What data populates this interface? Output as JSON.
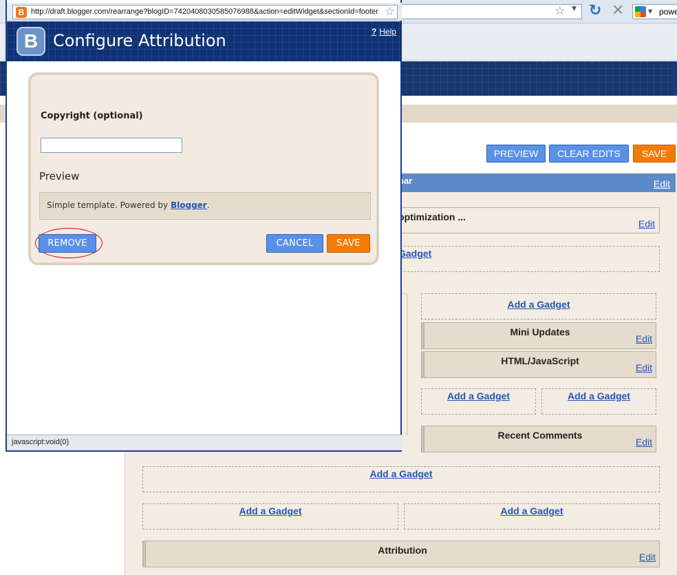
{
  "browser": {
    "search_text": "powe"
  },
  "page": {
    "actions": {
      "preview": "PREVIEW",
      "clear_edits": "CLEAR EDITS",
      "save": "SAVE"
    },
    "sidebar_title_fragment": "bar",
    "sidebar_edit": "Edit",
    "fragment_optimization": "optimization ...",
    "fragment_gadget": "Gadget",
    "edit_label": "Edit",
    "add_gadget": "Add a Gadget",
    "gadgets": {
      "mini_updates": "Mini Updates",
      "html_javascript": "HTML/JavaScript",
      "recent_comments": "Recent Comments",
      "attribution": "Attribution"
    }
  },
  "popup": {
    "url": "http://draft.blogger.com/rearrange?blogID=7420408030585076988&action=editWidget&sectionId=footer",
    "favicon_letter": "B",
    "logo_letter": "B",
    "title": "Configure Attribution",
    "help_label": "Help",
    "help_mark": "?",
    "copyright_label": "Copyright (optional)",
    "copyright_value": "",
    "preview_label": "Preview",
    "preview_text": "Simple template. Powered by",
    "preview_link": "Blogger",
    "preview_suffix": ".",
    "remove_label": "REMOVE",
    "cancel_label": "CANCEL",
    "save_label": "SAVE",
    "status_text": "javascript:void(0)"
  },
  "colors": {
    "header_navy": "#0f3176",
    "button_blue": "#5a90e6",
    "button_orange": "#f47b06",
    "panel_beige": "#f3ebe2",
    "link_blue": "#2255bb",
    "highlight_red": "#d0021b"
  },
  "icons": [
    "bookmark-star-icon",
    "dropdown-arrow-icon",
    "reload-icon",
    "stop-icon",
    "google-search-icon",
    "blogger-favicon",
    "blogger-logo",
    "help-icon"
  ]
}
